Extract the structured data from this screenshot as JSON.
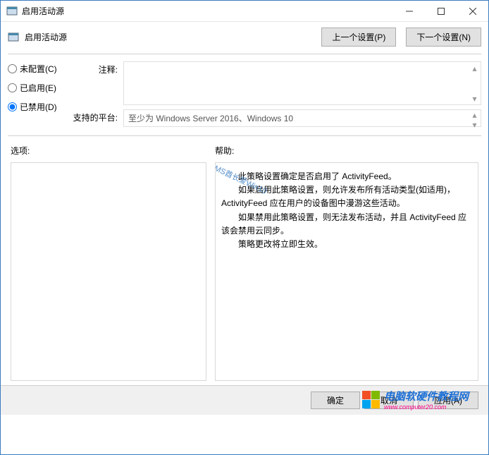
{
  "window": {
    "title": "启用活动源"
  },
  "header": {
    "title": "启用活动源",
    "prev_btn": "上一个设置(P)",
    "next_btn": "下一个设置(N)"
  },
  "radios": {
    "not_configured": "未配置(C)",
    "enabled": "已启用(E)",
    "disabled": "已禁用(D)",
    "selected": "disabled"
  },
  "fields": {
    "comment_label": "注释:",
    "comment_value": "",
    "platform_label": "支持的平台:",
    "platform_value": "至少为 Windows Server 2016、Windows 10"
  },
  "sections": {
    "options_label": "选项:",
    "help_label": "帮助:"
  },
  "help": {
    "p1": "此策略设置确定是否启用了 ActivityFeed。",
    "p2": "如果启用此策略设置，则允许发布所有活动类型(如适用)，ActivityFeed 应在用户的设备图中漫游这些活动。",
    "p3": "如果禁用此策略设置，则无法发布活动，并且 ActivityFeed 应该会禁用云同步。",
    "p4": "策略更改将立即生效。"
  },
  "footer": {
    "ok": "确定",
    "cancel": "取消",
    "apply": "应用(A)"
  },
  "watermarks": {
    "wm1": "MS酋长爱Win10",
    "wm2_line1": "电脑软硬件教程网",
    "wm2_line2": "www.computer20.com"
  }
}
